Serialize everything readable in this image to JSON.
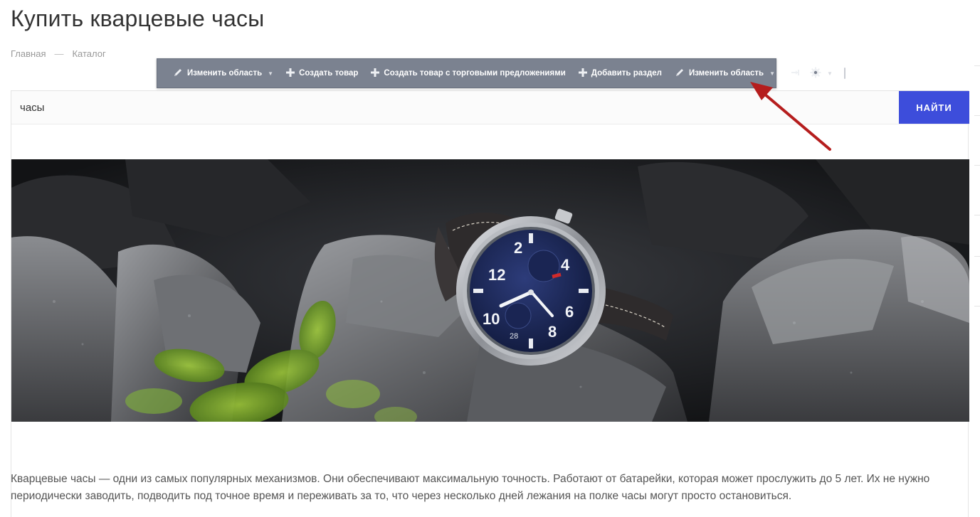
{
  "page": {
    "title": "Купить кварцевые часы"
  },
  "breadcrumb": {
    "items": [
      "Главная",
      "Каталог"
    ],
    "separator": "—"
  },
  "admin_toolbar": {
    "items": [
      {
        "label": "Изменить область",
        "icon": "pencil-icon",
        "has_dropdown": true
      },
      {
        "label": "Создать товар",
        "icon": "plus-icon",
        "has_dropdown": false
      },
      {
        "label": "Создать товар с торговыми предложениями",
        "icon": "plus-icon",
        "has_dropdown": false
      },
      {
        "label": "Добавить раздел",
        "icon": "plus-icon",
        "has_dropdown": false
      },
      {
        "label": "Изменить область",
        "icon": "pencil-icon",
        "has_dropdown": true
      }
    ],
    "pin_icon": "pin-icon",
    "settings_icon": "gear-icon",
    "background": "#7b8290"
  },
  "search": {
    "value": "часы",
    "button_label": "НАЙТИ",
    "button_color": "#3d4ddb"
  },
  "banner": {
    "subject": "wristwatch on dark rocks",
    "dial_numbers": [
      "2",
      "4",
      "6",
      "8",
      "10",
      "12"
    ],
    "date_window": "28"
  },
  "description": {
    "text": "Кварцевые часы — одни из самых популярных механизмов. Они обеспечивают максимальную точность. Работают от батарейки, которая может прослужить до 5 лет. Их не нужно периодически заводить, подводить под точное время и переживать за то, что через несколько дней лежания на полке часы могут просто остановиться."
  },
  "annotation": {
    "arrow_color": "#b51d1d",
    "points_to": "gear-icon"
  }
}
